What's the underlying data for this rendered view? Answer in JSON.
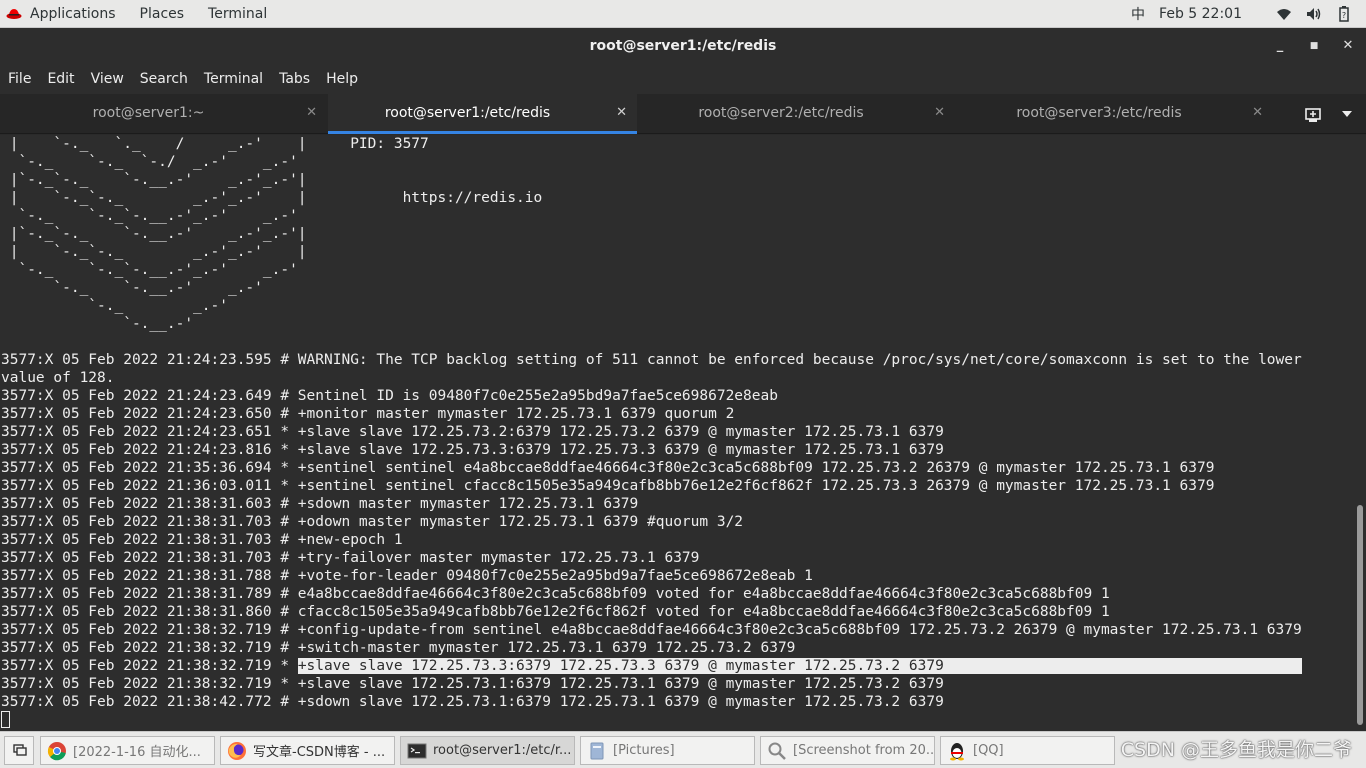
{
  "topbar": {
    "applications": "Applications",
    "places": "Places",
    "terminal": "Terminal",
    "input_method": "中",
    "datetime": "Feb 5  22:01"
  },
  "window": {
    "title": "root@server1:/etc/redis"
  },
  "menubar": [
    "File",
    "Edit",
    "View",
    "Search",
    "Terminal",
    "Tabs",
    "Help"
  ],
  "tabs": [
    {
      "label": "root@server1:~",
      "active": false
    },
    {
      "label": "root@server1:/etc/redis",
      "active": true
    },
    {
      "label": "root@server2:/etc/redis",
      "active": false
    },
    {
      "label": "root@server3:/etc/redis",
      "active": false
    }
  ],
  "terminal": {
    "lines": [
      " |    `-._   `._    /     _.-'    |     PID: 3577",
      "  `-._    `-._  `-./  _.-'    _.-'",
      " |`-._`-._    `-.__.-'    _.-'_.-'|",
      " |    `-._`-._        _.-'_.-'    |           https://redis.io",
      "  `-._    `-._`-.__.-'_.-'    _.-'",
      " |`-._`-._    `-.__.-'    _.-'_.-'|",
      " |    `-._`-._        _.-'_.-'    |",
      "  `-._    `-._`-.__.-'_.-'    _.-'",
      "      `-._    `-.__.-'    _.-'",
      "          `-._        _.-'",
      "              `-.__.-'",
      "",
      "3577:X 05 Feb 2022 21:24:23.595 # WARNING: The TCP backlog setting of 511 cannot be enforced because /proc/sys/net/core/somaxconn is set to the lower",
      "value of 128.",
      "3577:X 05 Feb 2022 21:24:23.649 # Sentinel ID is 09480f7c0e255e2a95bd9a7fae5ce698672e8eab",
      "3577:X 05 Feb 2022 21:24:23.650 # +monitor master mymaster 172.25.73.1 6379 quorum 2",
      "3577:X 05 Feb 2022 21:24:23.651 * +slave slave 172.25.73.2:6379 172.25.73.2 6379 @ mymaster 172.25.73.1 6379",
      "3577:X 05 Feb 2022 21:24:23.816 * +slave slave 172.25.73.3:6379 172.25.73.3 6379 @ mymaster 172.25.73.1 6379",
      "3577:X 05 Feb 2022 21:35:36.694 * +sentinel sentinel e4a8bccae8ddfae46664c3f80e2c3ca5c688bf09 172.25.73.2 26379 @ mymaster 172.25.73.1 6379",
      "3577:X 05 Feb 2022 21:36:03.011 * +sentinel sentinel cfacc8c1505e35a949cafb8bb76e12e2f6cf862f 172.25.73.3 26379 @ mymaster 172.25.73.1 6379",
      "3577:X 05 Feb 2022 21:38:31.603 # +sdown master mymaster 172.25.73.1 6379",
      "3577:X 05 Feb 2022 21:38:31.703 # +odown master mymaster 172.25.73.1 6379 #quorum 3/2",
      "3577:X 05 Feb 2022 21:38:31.703 # +new-epoch 1",
      "3577:X 05 Feb 2022 21:38:31.703 # +try-failover master mymaster 172.25.73.1 6379",
      "3577:X 05 Feb 2022 21:38:31.788 # +vote-for-leader 09480f7c0e255e2a95bd9a7fae5ce698672e8eab 1",
      "3577:X 05 Feb 2022 21:38:31.789 # e4a8bccae8ddfae46664c3f80e2c3ca5c688bf09 voted for e4a8bccae8ddfae46664c3f80e2c3ca5c688bf09 1",
      "3577:X 05 Feb 2022 21:38:31.860 # cfacc8c1505e35a949cafb8bb76e12e2f6cf862f voted for e4a8bccae8ddfae46664c3f80e2c3ca5c688bf09 1",
      "3577:X 05 Feb 2022 21:38:32.719 # +config-update-from sentinel e4a8bccae8ddfae46664c3f80e2c3ca5c688bf09 172.25.73.2 26379 @ mymaster 172.25.73.1 6379",
      "3577:X 05 Feb 2022 21:38:32.719 # +switch-master mymaster 172.25.73.1 6379 172.25.73.2 6379"
    ],
    "highlight_prefix": "3577:X 05 Feb 2022 21:38:32.719 * ",
    "highlight_text": "+slave slave 172.25.73.3:6379 172.25.73.3 6379 @ mymaster 172.25.73.2 6379",
    "after_lines": [
      "3577:X 05 Feb 2022 21:38:32.719 * +slave slave 172.25.73.1:6379 172.25.73.1 6379 @ mymaster 172.25.73.2 6379",
      "3577:X 05 Feb 2022 21:38:42.772 # +sdown slave 172.25.73.1:6379 172.25.73.1 6379 @ mymaster 172.25.73.2 6379"
    ]
  },
  "taskbar": {
    "items": [
      {
        "label": "[2022-1-16 自动化...",
        "icon": "chrome-icon",
        "active": false
      },
      {
        "label": "写文章-CSDN博客 - ...",
        "icon": "firefox-icon",
        "active": false
      },
      {
        "label": "root@server1:/etc/r...",
        "icon": "terminal-icon",
        "active": true
      },
      {
        "label": "[Pictures]",
        "icon": "folder-icon",
        "active": false
      },
      {
        "label": "[Screenshot from 20...",
        "icon": "image-viewer-icon",
        "active": false
      },
      {
        "label": "[QQ]",
        "icon": "qq-icon",
        "active": false
      }
    ],
    "watermark": "CSDN @王多鱼我是你二爷"
  }
}
